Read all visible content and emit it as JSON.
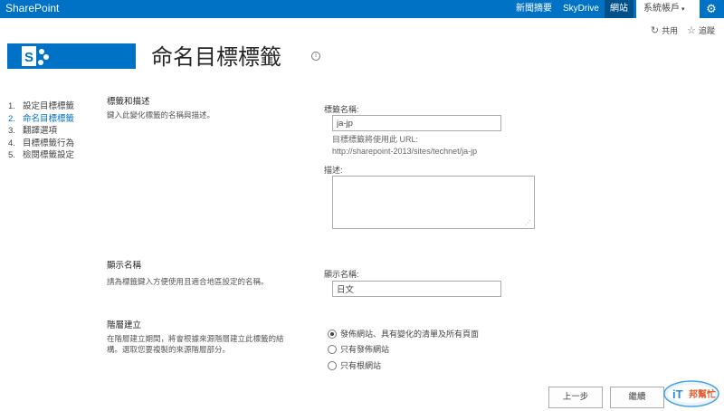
{
  "suitebar": {
    "brand": "SharePoint",
    "nav": [
      "新聞摘要",
      "SkyDrive",
      "網站"
    ],
    "active_nav": "網站",
    "user": "系統帳戶",
    "caret": "▾"
  },
  "actions": {
    "share": "共用",
    "follow": "追蹤"
  },
  "page": {
    "title": "命名目標標籤",
    "info": "i"
  },
  "steps": [
    {
      "num": "1.",
      "label": "設定目標標籤",
      "active": false
    },
    {
      "num": "2.",
      "label": "命名目標標籤",
      "active": true
    },
    {
      "num": "3.",
      "label": "翻譯選項",
      "active": false
    },
    {
      "num": "4.",
      "label": "目標標籤行為",
      "active": false
    },
    {
      "num": "5.",
      "label": "檢閱標籤設定",
      "active": false
    }
  ],
  "section_name": {
    "title": "標籤和描述",
    "desc": "鍵入此變化標籤的名稱與描述。",
    "label_name": "標籤名稱:",
    "name_value": "ja-jp",
    "url_hint_1": "目標標籤將使用此 URL:",
    "url_hint_2": "http://sharepoint-2013/sites/technet/ja-jp",
    "label_desc": "描述:",
    "desc_value": ""
  },
  "section_display": {
    "title": "顯示名稱",
    "desc": "請為標籤鍵入方便使用且適合地區設定的名稱。",
    "label": "顯示名稱:",
    "value": "日文"
  },
  "section_hierarchy": {
    "title": "階層建立",
    "desc_1": "在階層建立期間，將會根據來源階層建立此標籤的結",
    "desc_2": "構。選取您要複製的來源階層部分。",
    "options": [
      {
        "label": "發佈網站、具有變化的清單及所有頁面",
        "selected": true
      },
      {
        "label": "只有發佈網站",
        "selected": false
      },
      {
        "label": "只有根網站",
        "selected": false
      }
    ]
  },
  "buttons": {
    "back": "上一步",
    "continue": "繼續"
  },
  "watermark": {
    "text": "iT邦幫忙"
  },
  "colors": {
    "accent": "#0072c6"
  }
}
